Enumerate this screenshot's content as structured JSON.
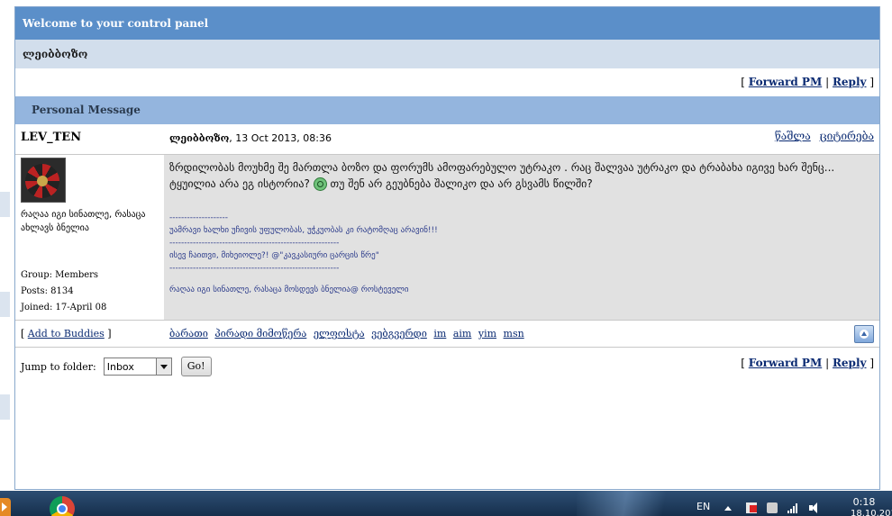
{
  "panel": {
    "title": "Welcome to your control panel",
    "subtitle": "ლეიბბოზო"
  },
  "top_links": {
    "forward": "Forward PM",
    "reply": "Reply",
    "open": "[",
    "sep": "|",
    "close": "]"
  },
  "pm_header": "Personal Message",
  "author": {
    "name": "LEV_TEN",
    "sender": "ლეიბბოზო",
    "date": ", 13 Oct 2013, 08:36",
    "delete": "წაშლა",
    "quote": "ციტირება",
    "tagline": "რაღაა იგი სინათლე, რასაცა ახლავს ბნელია",
    "group": "Group: Members",
    "posts": "Posts: 8134",
    "joined": "Joined: 17-April 08"
  },
  "message": {
    "line1": "ზრდილობას მოუხმე შე მართლა ბოზო და ფორუმს ამოფარებულო უტრაკო . რაც შალვაა უტრაკო და ტრაბახა იგივე ხარ შენც...",
    "line2a": "ტყუილია არა ეგ ისტორია?",
    "line2b": "თუ შენ არ გეუბნება შალიკო და არ გსვამს წილში?"
  },
  "signature": {
    "rule": "--------------------",
    "s1": "უამრავი ხალხი უჩივის უფულობას, უჭკუობას კი რატომღაც არავინ!!!",
    "rule2": "----------------------------------------------------------",
    "s2": "ისევ ჩაითვი, მიხეიოლე?! @\"კავკასიური ცარცის წრე\"",
    "rule3": "----------------------------------------------------------",
    "s3": "რაღაა იგი სინათლე, რასაცა მოსდევს ბნელია@ როსტეველი"
  },
  "footer": {
    "add_buddies": "Add to Buddies",
    "links": [
      "ბარათი",
      "პირადი მიმოწერა",
      "ელფოსტა",
      "ვებგვერდი",
      "im",
      "aim",
      "yim",
      "msn"
    ]
  },
  "bottom": {
    "jump_label": "Jump to folder:",
    "folder": "Inbox",
    "go": "Go!"
  },
  "taskbar": {
    "lang": "EN",
    "time": "0:18",
    "date": "18.10.2013"
  }
}
